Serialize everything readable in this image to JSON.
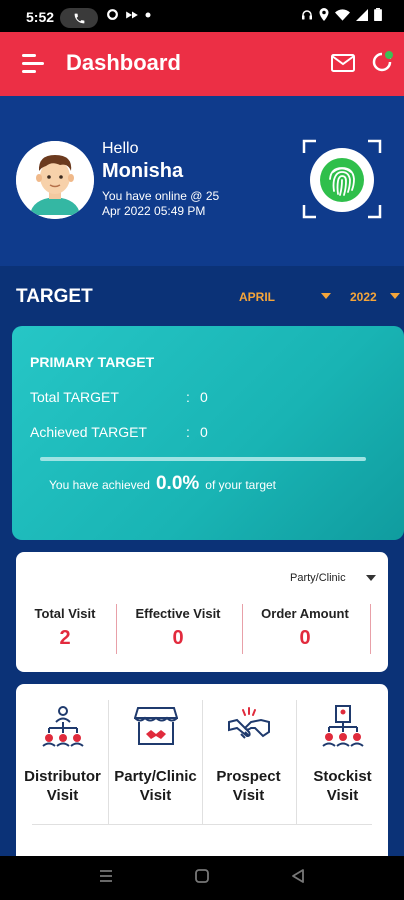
{
  "status": {
    "time": "5:52"
  },
  "app_bar": {
    "title": "Dashboard"
  },
  "profile": {
    "greeting": "Hello",
    "name": "Monisha",
    "online_line1": "You have online @ 25",
    "online_line2": "Apr 2022 05:49 PM"
  },
  "target": {
    "title": "TARGET",
    "month": "APRIL",
    "year": "2022"
  },
  "primary_target": {
    "title": "PRIMARY TARGET",
    "total_label": "Total TARGET",
    "total_value": "0",
    "achieved_label": "Achieved TARGET",
    "achieved_value": "0",
    "colon": ":",
    "achieved_prefix": "You have achieved",
    "achieved_percent": "0.0%",
    "achieved_suffix": "of your target",
    "progress_fraction": 0.0
  },
  "visits": {
    "filter": "Party/Clinic",
    "columns": [
      {
        "label": "Total Visit",
        "value": "2"
      },
      {
        "label": "Effective Visit",
        "value": "0"
      },
      {
        "label": "Order Amount",
        "value": "0"
      }
    ]
  },
  "menu": {
    "items": [
      {
        "line1": "Distributor",
        "line2": "Visit",
        "icon": "distributor-icon"
      },
      {
        "line1": "Party/Clinic",
        "line2": "Visit",
        "icon": "shop-icon"
      },
      {
        "line1": "Prospect",
        "line2": "Visit",
        "icon": "handshake-icon"
      },
      {
        "line1": "Stockist",
        "line2": "Visit",
        "icon": "stockist-icon"
      }
    ]
  },
  "colors": {
    "app_bar": "#ec2f45",
    "profile_bg": "#0f3b8c",
    "target_bg": "#0b3277",
    "accent_orange": "#f5a53a",
    "teal": "#1fb8b8",
    "value_red": "#e22a3d"
  }
}
